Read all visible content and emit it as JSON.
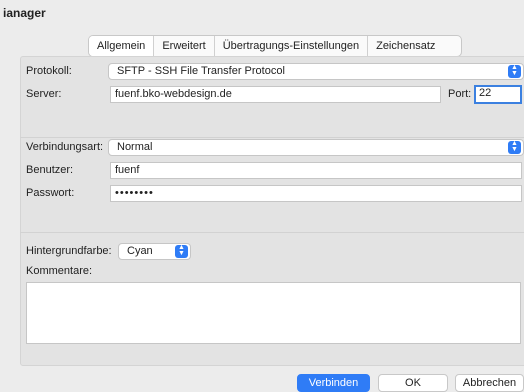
{
  "window": {
    "title": "ianager"
  },
  "tabs": [
    "Allgemein",
    "Erweitert",
    "Übertragungs-Einstellungen",
    "Zeichensatz"
  ],
  "form": {
    "protokoll_label": "Protokoll:",
    "protokoll_value": "SFTP - SSH File Transfer Protocol",
    "server_label": "Server:",
    "server_value": "fuenf.bko-webdesign.de",
    "port_label": "Port:",
    "port_value": "22",
    "verbindungsart_label": "Verbindungsart:",
    "verbindungsart_value": "Normal",
    "benutzer_label": "Benutzer:",
    "benutzer_value": "fuenf",
    "passwort_label": "Passwort:",
    "passwort_value": "••••••••",
    "hintergrund_label": "Hintergrundfarbe:",
    "hintergrund_value": "Cyan",
    "kommentare_label": "Kommentare:"
  },
  "buttons": {
    "connect": "Verbinden",
    "ok": "OK",
    "cancel": "Abbrechen"
  },
  "colors": {
    "accent": "#2f7cf6",
    "focus": "#3b80e0"
  }
}
